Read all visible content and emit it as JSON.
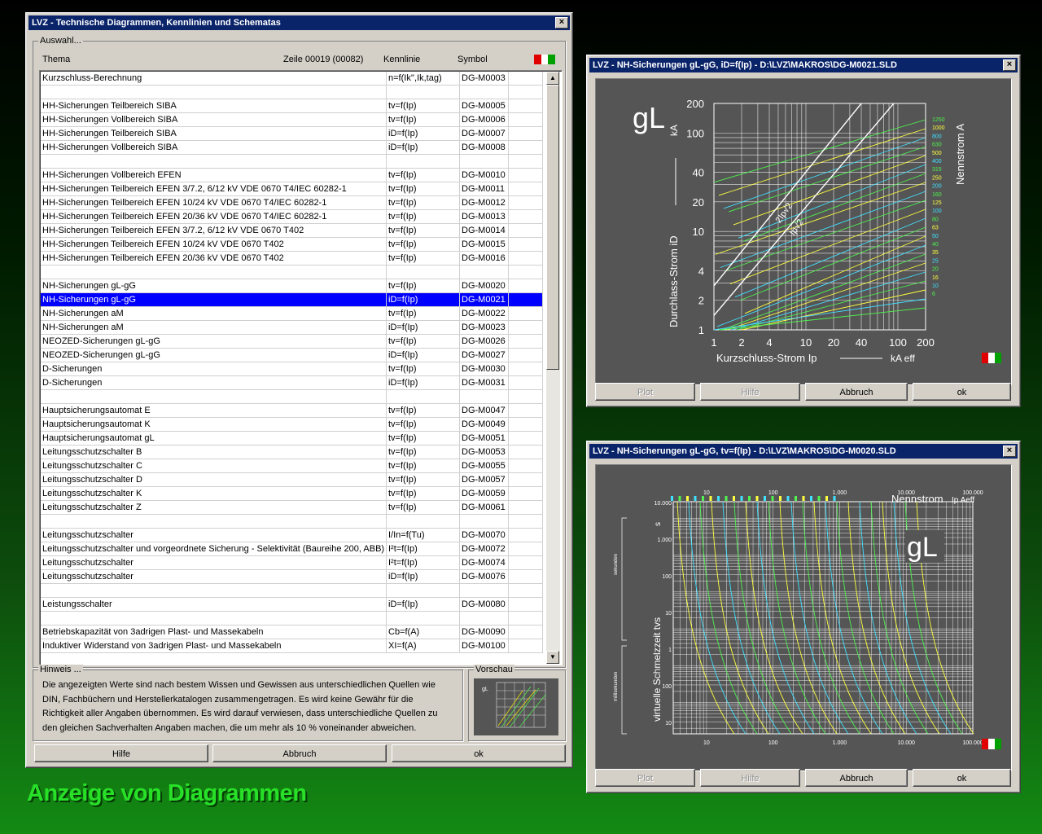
{
  "main_window": {
    "title": "LVZ - Technische Diagrammen, Kennlinien und Schematas",
    "group_label": "Auswahl...",
    "columns": {
      "topic": "Thema",
      "row_info": "Zeile 00019 (00082)",
      "curve": "Kennlinie",
      "symbol": "Symbol"
    },
    "rows": [
      {
        "topic": "Kurzschluss-Berechnung",
        "curve": "n=f(Ik'',Ik,tag)",
        "symbol": "DG-M0003"
      },
      {
        "topic": "",
        "curve": "",
        "symbol": ""
      },
      {
        "topic": "HH-Sicherungen Teilbereich SIBA",
        "curve": "tv=f(Ip)",
        "symbol": "DG-M0005"
      },
      {
        "topic": "HH-Sicherungen Vollbereich SIBA",
        "curve": "tv=f(Ip)",
        "symbol": "DG-M0006"
      },
      {
        "topic": "HH-Sicherungen Teilbereich SIBA",
        "curve": "iD=f(Ip)",
        "symbol": "DG-M0007"
      },
      {
        "topic": "HH-Sicherungen Vollbereich SIBA",
        "curve": "iD=f(Ip)",
        "symbol": "DG-M0008"
      },
      {
        "topic": "",
        "curve": "",
        "symbol": ""
      },
      {
        "topic": "HH-Sicherungen Vollbereich EFEN",
        "curve": "tv=f(Ip)",
        "symbol": "DG-M0010"
      },
      {
        "topic": "HH-Sicherungen Teilbereich EFEN 3/7.2, 6/12 kV VDE 0670 T4/IEC 60282-1",
        "curve": "tv=f(Ip)",
        "symbol": "DG-M0011"
      },
      {
        "topic": "HH-Sicherungen Teilbereich EFEN 10/24 kV VDE 0670 T4/IEC 60282-1",
        "curve": "tv=f(Ip)",
        "symbol": "DG-M0012"
      },
      {
        "topic": "HH-Sicherungen Teilbereich EFEN 20/36 kV VDE 0670 T4/IEC 60282-1",
        "curve": "tv=f(Ip)",
        "symbol": "DG-M0013"
      },
      {
        "topic": "HH-Sicherungen Teilbereich EFEN 3/7.2, 6/12 kV VDE 0670 T402",
        "curve": "tv=f(Ip)",
        "symbol": "DG-M0014"
      },
      {
        "topic": "HH-Sicherungen Teilbereich EFEN 10/24 kV VDE 0670 T402",
        "curve": "tv=f(Ip)",
        "symbol": "DG-M0015"
      },
      {
        "topic": "HH-Sicherungen Teilbereich EFEN 20/36 kV VDE 0670 T402",
        "curve": "tv=f(Ip)",
        "symbol": "DG-M0016"
      },
      {
        "topic": "",
        "curve": "",
        "symbol": ""
      },
      {
        "topic": "NH-Sicherungen gL-gG",
        "curve": "tv=f(Ip)",
        "symbol": "DG-M0020"
      },
      {
        "topic": "NH-Sicherungen gL-gG",
        "curve": "iD=f(Ip)",
        "symbol": "DG-M0021",
        "selected": true
      },
      {
        "topic": "NH-Sicherungen aM",
        "curve": "tv=f(Ip)",
        "symbol": "DG-M0022"
      },
      {
        "topic": "NH-Sicherungen aM",
        "curve": "iD=f(Ip)",
        "symbol": "DG-M0023"
      },
      {
        "topic": "NEOZED-Sicherungen gL-gG",
        "curve": "tv=f(Ip)",
        "symbol": "DG-M0026"
      },
      {
        "topic": "NEOZED-Sicherungen gL-gG",
        "curve": "iD=f(Ip)",
        "symbol": "DG-M0027"
      },
      {
        "topic": "D-Sicherungen",
        "curve": "tv=f(Ip)",
        "symbol": "DG-M0030"
      },
      {
        "topic": "D-Sicherungen",
        "curve": "iD=f(Ip)",
        "symbol": "DG-M0031"
      },
      {
        "topic": "",
        "curve": "",
        "symbol": ""
      },
      {
        "topic": "Hauptsicherungsautomat E",
        "curve": "tv=f(Ip)",
        "symbol": "DG-M0047"
      },
      {
        "topic": "Hauptsicherungsautomat K",
        "curve": "tv=f(Ip)",
        "symbol": "DG-M0049"
      },
      {
        "topic": "Hauptsicherungsautomat gL",
        "curve": "tv=f(Ip)",
        "symbol": "DG-M0051"
      },
      {
        "topic": "Leitungsschutzschalter B",
        "curve": "tv=f(Ip)",
        "symbol": "DG-M0053"
      },
      {
        "topic": "Leitungsschutzschalter C",
        "curve": "tv=f(Ip)",
        "symbol": "DG-M0055"
      },
      {
        "topic": "Leitungsschutzschalter D",
        "curve": "tv=f(Ip)",
        "symbol": "DG-M0057"
      },
      {
        "topic": "Leitungsschutzschalter K",
        "curve": "tv=f(Ip)",
        "symbol": "DG-M0059"
      },
      {
        "topic": "Leitungsschutzschalter Z",
        "curve": "tv=f(Ip)",
        "symbol": "DG-M0061"
      },
      {
        "topic": "",
        "curve": "",
        "symbol": ""
      },
      {
        "topic": "Leitungsschutzschalter",
        "curve": "I/In=f(Tu)",
        "symbol": "DG-M0070"
      },
      {
        "topic": "Leitungsschutzschalter und vorgeordnete Sicherung - Selektivität (Baureihe 200, ABB)",
        "curve": "I²t=f(Ip)",
        "symbol": "DG-M0072"
      },
      {
        "topic": "Leitungsschutzschalter",
        "curve": "I²t=f(Ip)",
        "symbol": "DG-M0074"
      },
      {
        "topic": "Leitungsschutzschalter",
        "curve": "iD=f(Ip)",
        "symbol": "DG-M0076"
      },
      {
        "topic": "",
        "curve": "",
        "symbol": ""
      },
      {
        "topic": "Leistungsschalter",
        "curve": "iD=f(Ip)",
        "symbol": "DG-M0080"
      },
      {
        "topic": "",
        "curve": "",
        "symbol": ""
      },
      {
        "topic": "Betriebskapazität von 3adrigen Plast- und Massekabeln",
        "curve": "Cb=f(A)",
        "symbol": "DG-M0090"
      },
      {
        "topic": "Induktiver Widerstand von 3adrigen Plast- und Massekabeln",
        "curve": "XI=f(A)",
        "symbol": "DG-M0100"
      }
    ],
    "hint_label": "Hinweis ...",
    "hint_text": "Die angezeigten Werte sind nach bestem Wissen und Gewissen aus unterschiedlichen Quellen wie DIN, Fachbüchern und Herstellerkatalogen zusammengetragen. Es wird keine Gewähr für die Richtigkeit aller Angaben übernommen. Es wird darauf verwiesen, dass unterschiedliche Quellen zu den gleichen Sachverhalten Angaben machen, die um mehr als 10 % voneinander abweichen.",
    "preview_label": "Vorschau",
    "buttons": {
      "help": "Hilfe",
      "cancel": "Abbruch",
      "ok": "ok"
    }
  },
  "window_id": {
    "title": "LVZ - NH-Sicherungen gL-gG, iD=f(Ip) - D:\\LVZ\\MAKROS\\DG-M0021.SLD",
    "buttons": {
      "plot": "Plot",
      "help": "Hilfe",
      "cancel": "Abbruch",
      "ok": "ok"
    },
    "diagram": {
      "logo": "gL",
      "y_axis_label": "Durchlass-Strom",
      "y_axis_symbol": "iD",
      "y_unit": "kA",
      "x_axis_label": "Kurzschluss-Strom",
      "x_axis_symbol": "Ip",
      "x_unit": "kA eff",
      "rating_label": "Nennstrom A",
      "y_ticks": [
        "200",
        "100",
        "40",
        "20",
        "10",
        "4",
        "2",
        "1"
      ],
      "x_ticks": [
        "1",
        "2",
        "4",
        "10",
        "20",
        "40",
        "100",
        "200"
      ],
      "line_labels": [
        "2Ip√2",
        "Ip√2"
      ],
      "ratings": [
        "1250",
        "1000",
        "800",
        "630",
        "500",
        "400",
        "315",
        "250",
        "200",
        "160",
        "125",
        "100",
        "80",
        "63",
        "50",
        "40",
        "35",
        "25",
        "20",
        "16",
        "10",
        "6"
      ]
    }
  },
  "window_tv": {
    "title": "LVZ - NH-Sicherungen gL-gG, tv=f(Ip) - D:\\LVZ\\MAKROS\\DG-M0020.SLD",
    "buttons": {
      "plot": "Plot",
      "help": "Hilfe",
      "cancel": "Abbruch",
      "ok": "ok"
    },
    "diagram": {
      "logo": "gL",
      "rating_label": "Nennstrom",
      "rating_symbol": "Ip Aeff",
      "y_axis_label": "virtuelle Schmelzzeit tvs",
      "y_unit": "s",
      "seconds_label": "sekunden",
      "ms_label": "millisekunden",
      "x_ticks": [
        "10",
        "100",
        "1.000",
        "10.000",
        "100.000"
      ],
      "y_ticks": [
        "10.000",
        "1.000",
        "100",
        "10",
        "1",
        "100",
        "10"
      ]
    }
  },
  "caption": "Anzeige von Diagrammen",
  "colors": {
    "title_bar": "#0a246a",
    "selection": "#0000ff",
    "flag_red": "#e00000",
    "flag_green": "#00a000",
    "caption": "#28e028"
  }
}
